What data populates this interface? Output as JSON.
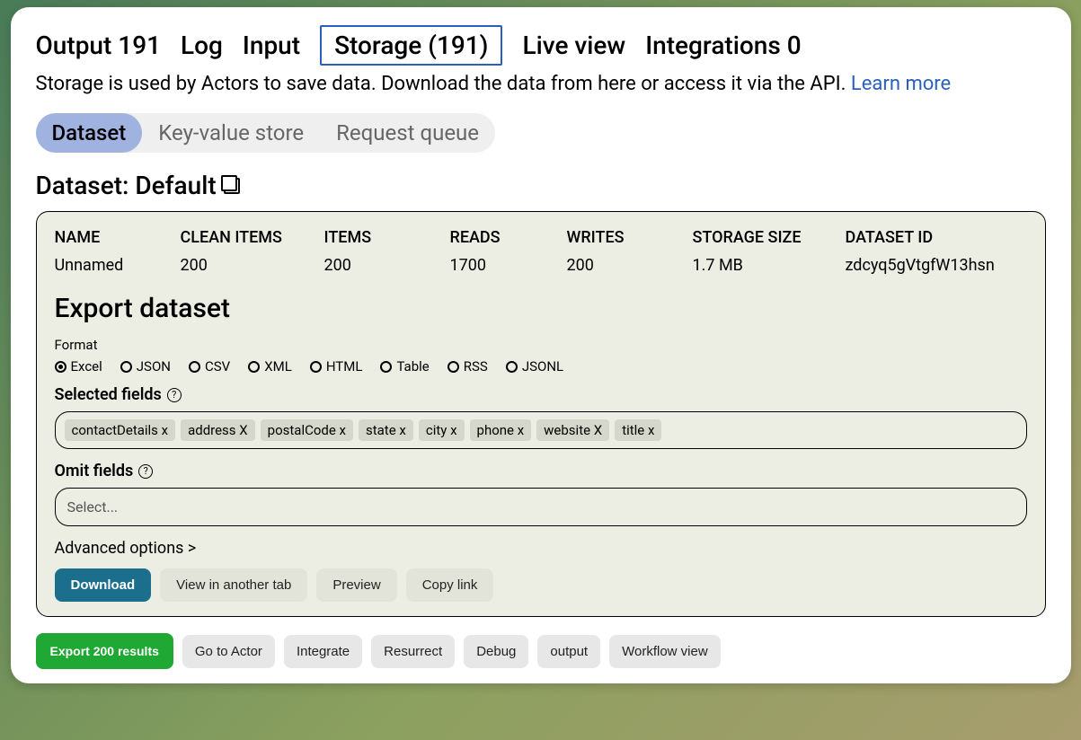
{
  "tabs": {
    "output": "Output 191",
    "log": "Log",
    "input": "Input",
    "storage": "Storage (191)",
    "liveview": "Live view",
    "integrations": "Integrations 0"
  },
  "description": "Storage is used by Actors to save data. Download the data from here or access it via the API.",
  "learn_more": "Learn more",
  "sub_tabs": {
    "dataset": "Dataset",
    "kv": "Key-value store",
    "rq": "Request queue"
  },
  "dataset_title": "Dataset: Default",
  "stats": {
    "headers": {
      "name": "NAME",
      "clean_items": "CLEAN ITEMS",
      "items": "ITEMS",
      "reads": "READS",
      "writes": "WRITES",
      "storage_size": "STORAGE SIZE",
      "dataset_id": "DATASET ID"
    },
    "values": {
      "name": "Unnamed",
      "clean_items": "200",
      "items": "200",
      "reads": "1700",
      "writes": "200",
      "storage_size": "1.7 MB",
      "dataset_id": "zdcyq5gVtgfW13hsn"
    }
  },
  "export_title": "Export dataset",
  "format_label": "Format",
  "formats": [
    {
      "name": "Excel",
      "selected": true
    },
    {
      "name": "JSON",
      "selected": false
    },
    {
      "name": "CSV",
      "selected": false
    },
    {
      "name": "XML",
      "selected": false
    },
    {
      "name": "HTML",
      "selected": false
    },
    {
      "name": "Table",
      "selected": false
    },
    {
      "name": "RSS",
      "selected": false
    },
    {
      "name": "JSONL",
      "selected": false
    }
  ],
  "selected_fields_label": "Selected fields",
  "selected_fields": [
    "contactDetails x",
    "address X",
    "postalCode x",
    "state x",
    "city x",
    "phone x",
    "website X",
    "title x"
  ],
  "omit_fields_label": "Omit fields",
  "omit_placeholder": "Select...",
  "advanced_options": "Advanced options >",
  "buttons": {
    "download": "Download",
    "view_tab": "View in another tab",
    "preview": "Preview",
    "copy_link": "Copy link"
  },
  "bottom": {
    "export": "Export 200 results",
    "go_to_actor": "Go to Actor",
    "integrate": "Integrate",
    "resurrect": "Resurrect",
    "debug": "Debug",
    "output": "output",
    "workflow": "Workflow view"
  }
}
